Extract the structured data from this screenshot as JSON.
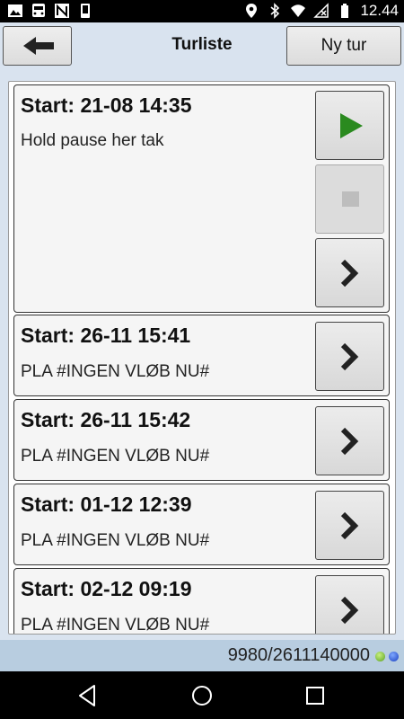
{
  "status_bar": {
    "time": "12.44"
  },
  "header": {
    "title": "Turliste",
    "back_icon": "arrow-left-icon",
    "new_label": "Ny tur"
  },
  "trips": [
    {
      "start": "Start: 21-08 14:35",
      "description": "Hold pause her tak"
    },
    {
      "start": "Start: 26-11 15:41",
      "description": "PLA #INGEN VLØB NU#"
    },
    {
      "start": "Start: 26-11 15:42",
      "description": "PLA #INGEN VLØB NU#"
    },
    {
      "start": "Start: 01-12 12:39",
      "description": "PLA #INGEN VLØB NU#"
    },
    {
      "start": "Start: 02-12 09:19",
      "description": "PLA #INGEN VLØB NU#"
    }
  ],
  "footer": {
    "id_text": "9980/2611140000"
  },
  "colors": {
    "play": "#2a8a1f",
    "accent": "#d9e3ef",
    "footer_bg": "#b8cde0"
  }
}
